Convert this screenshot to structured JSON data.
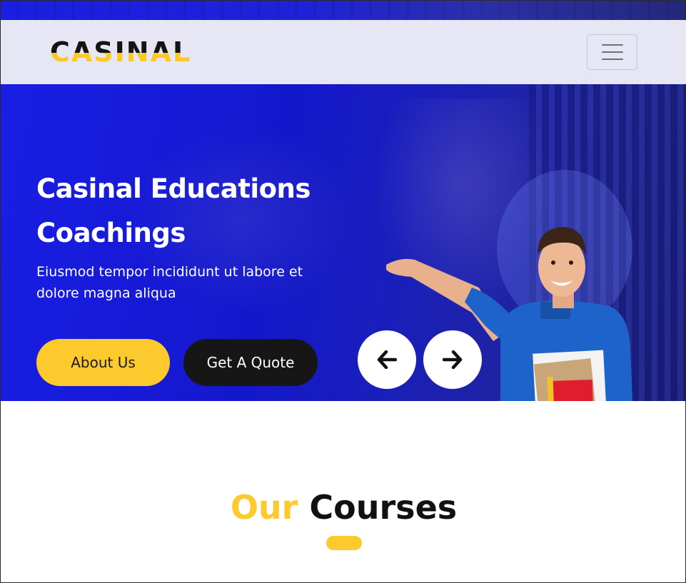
{
  "brand": {
    "logo_text": "CASINAL"
  },
  "navbar": {
    "menu_icon": "hamburger-menu-icon"
  },
  "hero": {
    "title": "Casinal Educations Coachings",
    "subtitle": "Eiusmod tempor incididunt ut labore et dolore magna aliqua",
    "buttons": {
      "about": "About Us",
      "quote": "Get A Quote"
    },
    "carousel": {
      "prev_icon": "arrow-left-icon",
      "next_icon": "arrow-right-icon"
    }
  },
  "courses": {
    "title_highlight": "Our",
    "title_rest": "Courses"
  },
  "colors": {
    "primary_blue": "#1a1ee4",
    "accent_yellow": "#fdca2e",
    "dark": "#161616",
    "navbar_bg": "#e6e6f4"
  }
}
